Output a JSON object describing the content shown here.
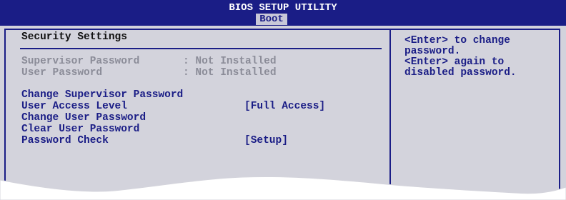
{
  "header": {
    "title": "BIOS SETUP UTILITY",
    "active_tab": "Boot"
  },
  "main": {
    "section_title": "Security Settings",
    "status": [
      {
        "label": "Supervisor Password",
        "value": ": Not Installed"
      },
      {
        "label": "User Password",
        "value": ": Not Installed"
      }
    ],
    "items": [
      {
        "label": "Change Supervisor Password",
        "value": ""
      },
      {
        "label": "User Access Level",
        "value": "[Full Access]"
      },
      {
        "label": "Change User Password",
        "value": ""
      },
      {
        "label": "Clear User Password",
        "value": ""
      },
      {
        "label": "Password Check",
        "value": "[Setup]"
      }
    ]
  },
  "help": {
    "lines": [
      "<Enter> to change",
      "password.",
      "<Enter> again to",
      "disabled password."
    ]
  },
  "colors": {
    "bios_blue": "#1a1d86",
    "panel_gray": "#d3d3dc",
    "disabled_text": "#8b8c98"
  }
}
